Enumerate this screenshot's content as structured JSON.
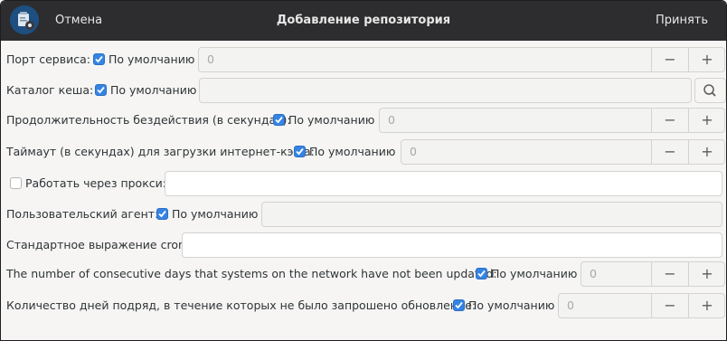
{
  "header": {
    "cancel_label": "Отмена",
    "title": "Добавление репозитория",
    "accept_label": "Принять"
  },
  "rows": [
    {
      "label": "Порт сервиса:",
      "checkbox_label": "По умолчанию",
      "checked": true,
      "value": "0"
    },
    {
      "label": "Каталог кеша:",
      "checkbox_label": "По умолчанию",
      "checked": true,
      "value": ""
    },
    {
      "label": "Продолжительность бездействия (в секундах):",
      "checkbox_label": "По умолчанию",
      "checked": true,
      "value": "0"
    },
    {
      "label": "Таймаут (в секундах) для загрузки интернет-кэша:",
      "checkbox_label": "По умолчанию",
      "checked": true,
      "value": "0"
    },
    {
      "label": "Работать через прокси:",
      "checked": false,
      "value": ""
    },
    {
      "label": "Пользовательский агент:",
      "checkbox_label": "По умолчанию",
      "checked": true,
      "value": ""
    },
    {
      "label": "Стандартное выражение cron:",
      "value": ""
    },
    {
      "label": "The number of consecutive days that systems on the network have not been updated:",
      "checkbox_label": "По умолчанию",
      "checked": true,
      "value": "0"
    },
    {
      "label": "Количество дней подряд, в течение которых не было запрошено обновление:",
      "checkbox_label": "По умолчанию",
      "checked": true,
      "value": "0"
    }
  ],
  "spin": {
    "minus": "−",
    "plus": "+"
  },
  "colors": {
    "header_bg": "#2d2d2f",
    "accent": "#3584e4",
    "window_bg": "#f6f5f4"
  }
}
